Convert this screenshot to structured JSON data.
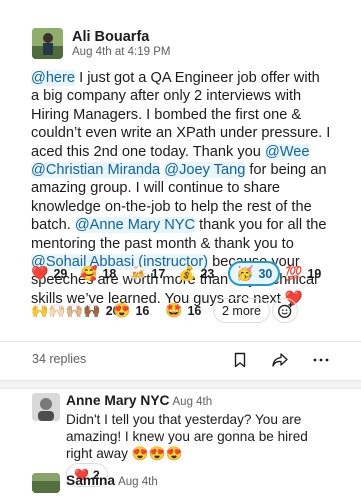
{
  "post": {
    "author": "Ali Bouarfa",
    "timestamp": "Aug 4th at 4:19 PM",
    "segments": [
      {
        "type": "mention",
        "text": "@here"
      },
      {
        "type": "text",
        "text": " I just got a QA Engineer job offer with a big company after only 2 interviews with Hiring Managers. I bombed the first one & couldn’t even write an XPath under pressure. I aced this 2nd one today. Thank you "
      },
      {
        "type": "mention",
        "text": "@Wee"
      },
      {
        "type": "text",
        "text": " "
      },
      {
        "type": "mention",
        "text": "@Christian Miranda"
      },
      {
        "type": "text",
        "text": " "
      },
      {
        "type": "mention",
        "text": "@Joey Tang"
      },
      {
        "type": "text",
        "text": " for being an amazing group. I will continue to share knowledge on-the-job to help the rest of the batch. "
      },
      {
        "type": "mention",
        "text": "@Anne Mary NYC"
      },
      {
        "type": "text",
        "text": " thank you for all the mentoring the past month & thank you to "
      },
      {
        "type": "mention",
        "text": "@Sohail Abbasi (instructor)"
      },
      {
        "type": "text",
        "text": " because your speeches are worth more than any technical skills we’ve learned. You guys are next "
      },
      {
        "type": "heart",
        "text": "❤️"
      }
    ]
  },
  "reactions": {
    "row1": [
      {
        "emoji": "❤️",
        "icon": "red-heart-icon",
        "count": "29"
      },
      {
        "emoji": "🥰",
        "icon": "smiling-face-with-hearts-icon",
        "count": "18"
      },
      {
        "emoji": "🍻",
        "icon": "clinking-beer-mugs-icon",
        "count": "17"
      },
      {
        "emoji": "💰",
        "icon": "money-bag-icon",
        "count": "23"
      },
      {
        "emoji": "🥳",
        "icon": "partying-face-icon",
        "count": "30",
        "selected": true
      },
      {
        "emoji": "💯",
        "icon": "hundred-points-icon",
        "count": "19"
      }
    ],
    "row2": [
      {
        "emoji": "🙌🙌🏻🙌🏼🙌🏾",
        "icon": "raising-hands-icon",
        "count": "26"
      },
      {
        "emoji": "😍",
        "icon": "heart-eyes-icon",
        "count": "16"
      },
      {
        "emoji": "🤩",
        "icon": "star-struck-icon",
        "count": "16"
      }
    ],
    "more_label": "2 more"
  },
  "thread": {
    "replies_label": "34 replies"
  },
  "replies": [
    {
      "author": "Anne Mary NYC",
      "time": "Aug 4th",
      "text": "Didn't I tell you that yesterday? You are amazing! I knew you are gonna be hired right away 😍😍😍",
      "reaction": {
        "emoji": "❤️",
        "count": "2"
      }
    },
    {
      "author": "Samina",
      "time": "Aug 4th"
    }
  ],
  "colors": {
    "mention": "#1264a3",
    "mention_bg": "#e8f5fa",
    "selected_border": "#1d9bd1",
    "heart": "#e0245e"
  }
}
